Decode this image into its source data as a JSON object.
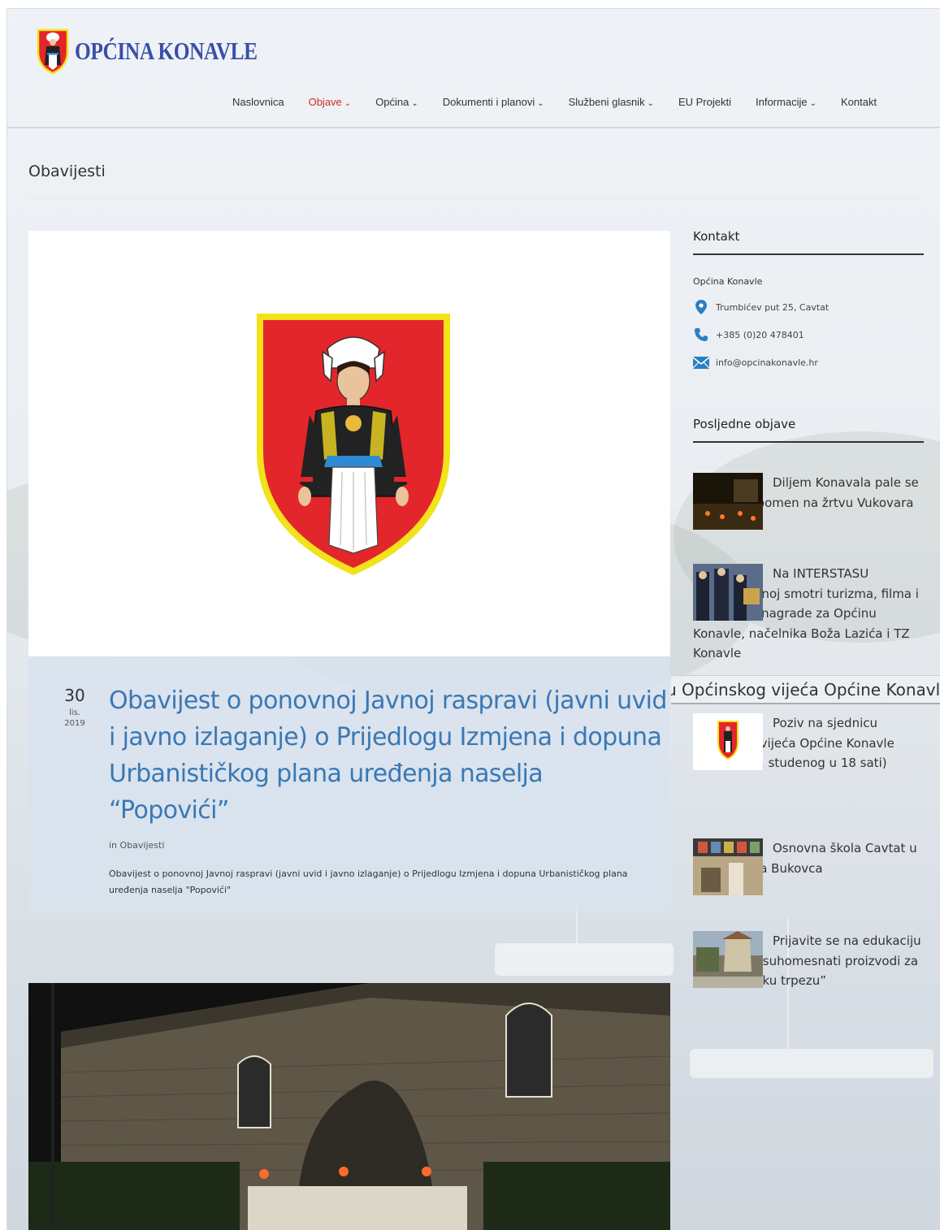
{
  "site": {
    "brand": "OPĆINA KONAVLE"
  },
  "nav": [
    {
      "label": "Naslovnica",
      "dropdown": false,
      "active": false
    },
    {
      "label": "Objave",
      "dropdown": true,
      "active": true
    },
    {
      "label": "Općina",
      "dropdown": true,
      "active": false
    },
    {
      "label": "Dokumenti i planovi",
      "dropdown": true,
      "active": false
    },
    {
      "label": "Službeni glasnik",
      "dropdown": true,
      "active": false
    },
    {
      "label": "EU Projekti",
      "dropdown": false,
      "active": false
    },
    {
      "label": "Informacije",
      "dropdown": true,
      "active": false
    },
    {
      "label": "Kontakt",
      "dropdown": false,
      "active": false
    }
  ],
  "page": {
    "title": "Obavijesti"
  },
  "post": {
    "day": "30",
    "month": "lis.",
    "year": "2019",
    "title": "Obavijest o ponovnoj Javnoj raspravi (javni uvid i javno izlaganje) o Prijedlogu Izmjena i dopuna Urbanističkog plana uređenja naselja “Popovići”",
    "meta_prefix": "in",
    "category": "Obavijesti",
    "excerpt": "Obavijest o ponovnoj Javnoj raspravi (javni uvid i javno izlaganje) o Prijedlogu Izmjena i dopuna Urbanističkog plana uređenja naselja \"Popovići\""
  },
  "sidebar": {
    "contact_title": "Kontakt",
    "org": "Općina Konavle",
    "address": "Trumbićev put 25, Cavtat",
    "phone": "+385 (0)20 478401",
    "email": "info@opcinakonavle.hr",
    "recent_title": "Posljedne objave",
    "recent": [
      {
        "title": "Diljem Konavala pale se svijeće u spomen na žrtvu Vukovara"
      },
      {
        "title": "Na INTERSTASU Međunarodnoj smotri turizma, filma i krajobraza nagrade za Općinu Konavle, načelnika Boža Lazića i TZ Konavle"
      },
      {
        "title": "Poziv na sjednicu Općinskog vijeća Općine Konavle (utorak, 26. studenog u 18 sati)"
      },
      {
        "title": "Osnovna škola Cavtat u znaku Vlaha Bukovca"
      },
      {
        "title": "Prijavite se na edukaciju ”Tradicijski suhomesnati proizvodi za agroturističku trpezu”"
      }
    ]
  },
  "ticker": {
    "text": "u Općinskog vijeća Općine Konavle"
  },
  "colors": {
    "brand": "#3a4fa8",
    "link": "#3a78b4",
    "active_nav": "#d02a2a",
    "shield_red": "#e3262b",
    "shield_border": "#f2e21a"
  }
}
